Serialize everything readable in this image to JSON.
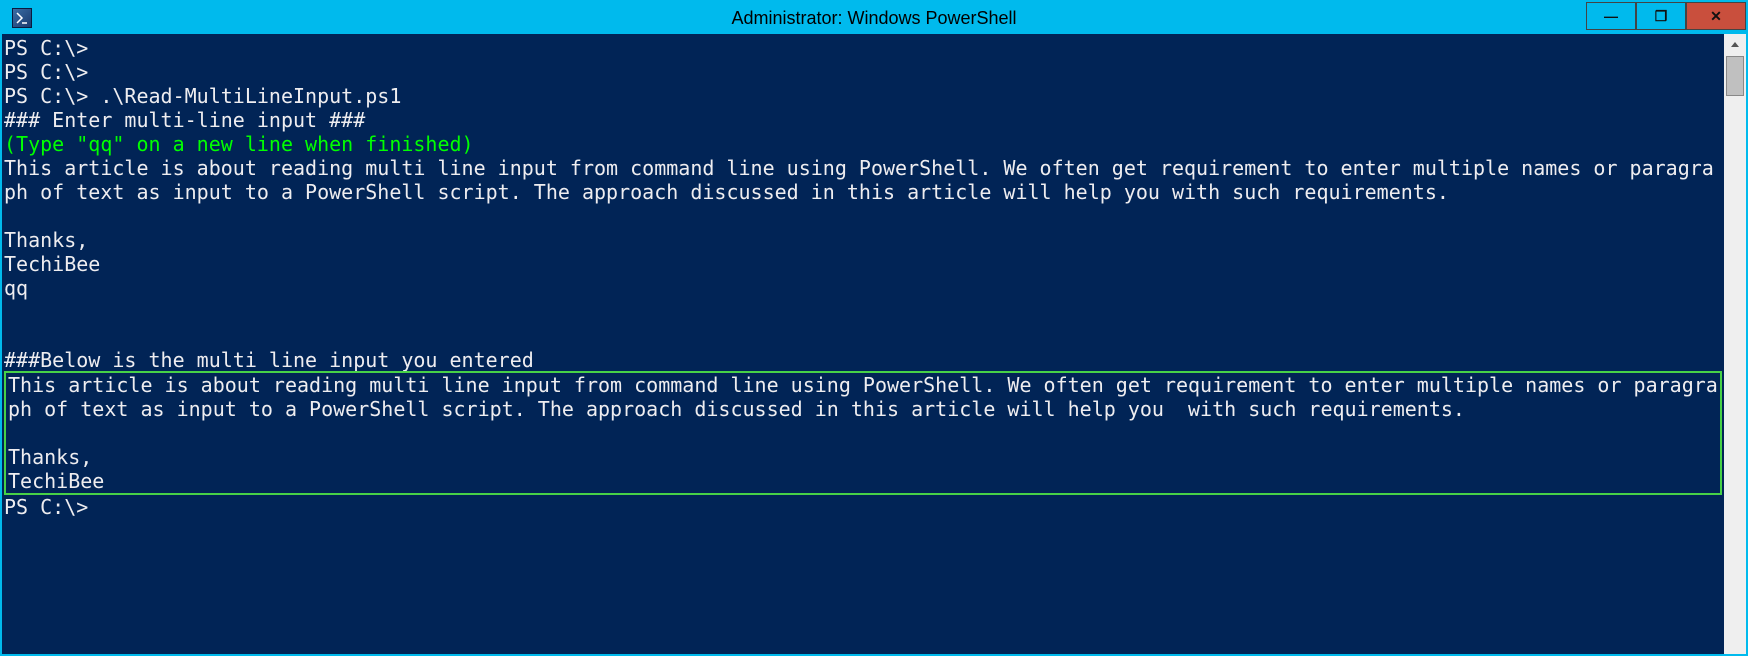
{
  "window": {
    "title": "Administrator: Windows PowerShell",
    "controls": {
      "min": "—",
      "max": "❐",
      "close": "✕"
    }
  },
  "console": {
    "prompt1": "PS C:\\>",
    "prompt2": "PS C:\\>",
    "prompt3": "PS C:\\> .\\Read-MultiLineInput.ps1",
    "header_input": "### Enter multi-line input ###",
    "hint": "(Type \"qq\" on a new line when finished)",
    "input_paragraph": "This article is about reading multi line input from command line using PowerShell. We often get requirement to enter multiple names or paragraph of text as input to a PowerShell script. The approach discussed in this article will help you with such requirements.",
    "input_thanks": "Thanks,",
    "input_signature": "TechiBee",
    "input_terminator": "qq",
    "header_output": "###Below is the multi line input you entered",
    "output_paragraph": "This article is about reading multi line input from command line using PowerShell. We often get requirement to enter multiple names or paragraph of text as input to a PowerShell script. The approach discussed in this article will help you  with such requirements.",
    "output_thanks": "Thanks,",
    "output_signature": "TechiBee",
    "prompt4": "PS C:\\>"
  },
  "colors": {
    "titlebar": "#00baed",
    "console_bg": "#012456",
    "console_fg": "#eeedf0",
    "hint_green": "#00ff00",
    "box_green": "#47d147",
    "close_red": "#c94f3d"
  }
}
